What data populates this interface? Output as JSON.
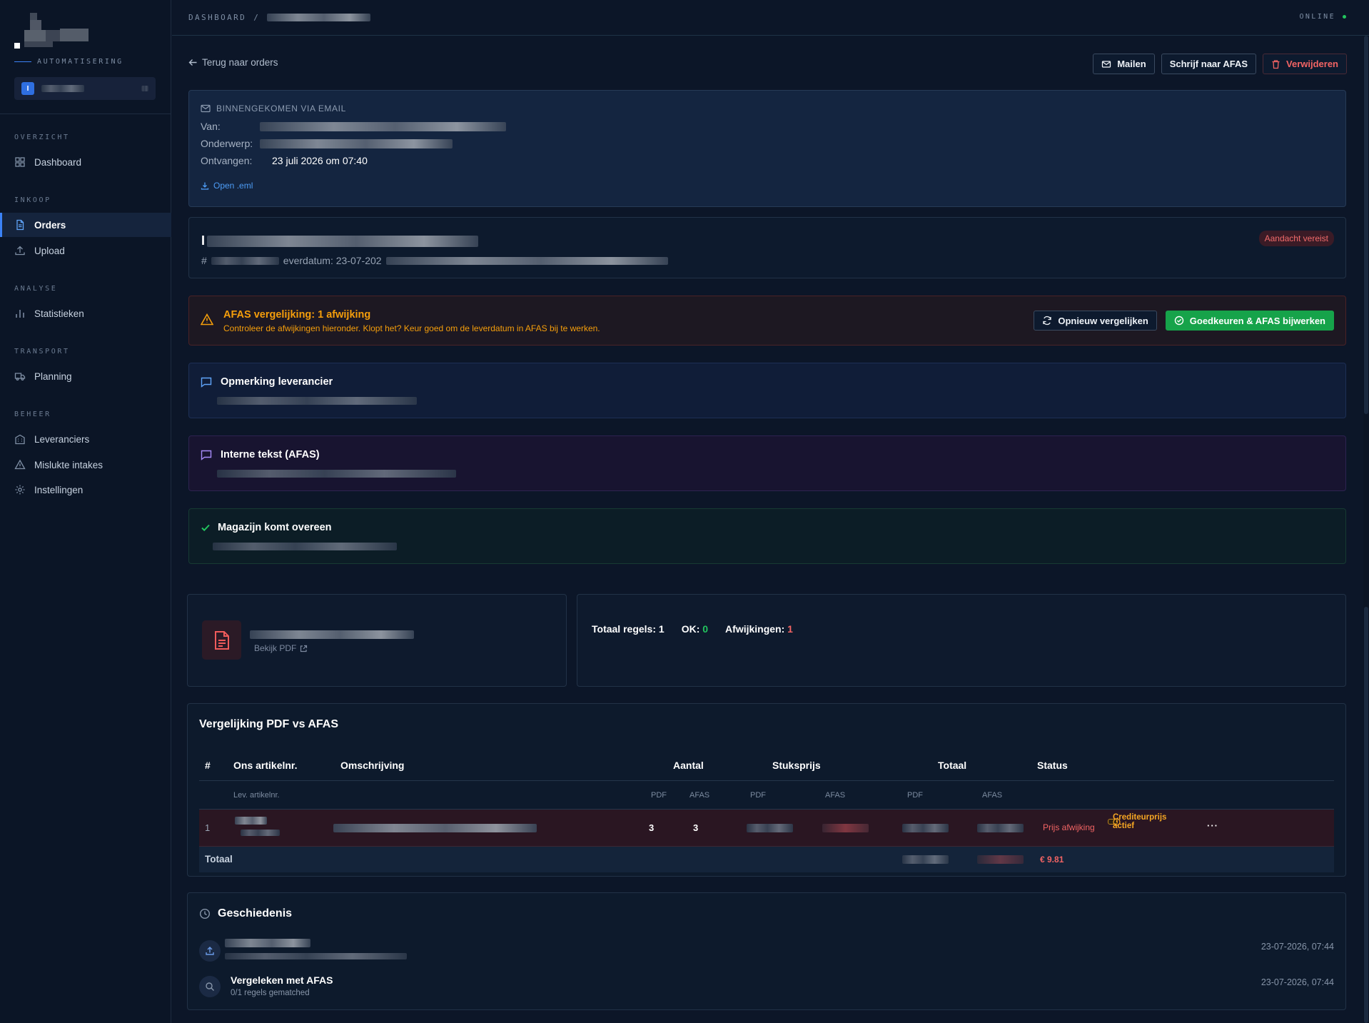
{
  "brand": {
    "subtitle": "AUTOMATISERING",
    "org_badge": "I"
  },
  "nav": {
    "sections": [
      {
        "label": "OVERZICHT",
        "items": [
          {
            "label": "Dashboard",
            "icon": "grid-icon"
          }
        ]
      },
      {
        "label": "INKOOP",
        "items": [
          {
            "label": "Orders",
            "icon": "document-icon",
            "active": true
          },
          {
            "label": "Upload",
            "icon": "upload-icon"
          }
        ]
      },
      {
        "label": "ANALYSE",
        "items": [
          {
            "label": "Statistieken",
            "icon": "bar-chart-icon"
          }
        ]
      },
      {
        "label": "TRANSPORT",
        "items": [
          {
            "label": "Planning",
            "icon": "truck-icon"
          }
        ]
      },
      {
        "label": "BEHEER",
        "items": [
          {
            "label": "Leveranciers",
            "icon": "building-icon"
          },
          {
            "label": "Mislukte intakes",
            "icon": "warning-icon"
          },
          {
            "label": "Instellingen",
            "icon": "gear-icon"
          }
        ]
      }
    ]
  },
  "topbar": {
    "breadcrumb_root": "DASHBOARD",
    "breadcrumb_sep": "/",
    "status": "ONLINE"
  },
  "toolbar": {
    "back": "Terug naar orders",
    "mail": "Mailen",
    "write_afas": "Schrijf naar AFAS",
    "delete": "Verwijderen"
  },
  "email": {
    "heading": "BINNENGEKOMEN VIA EMAIL",
    "from_label": "Van:",
    "subject_label": "Onderwerp:",
    "received_label": "Ontvangen:",
    "received_value": "23 juli 2026 om 07:40",
    "open_eml": "Open .eml"
  },
  "order": {
    "title_prefix": "I",
    "meta_hash": "#",
    "meta_delivery": "everdatum: 23-07-202",
    "badge": "Aandacht vereist"
  },
  "afas_compare": {
    "title": "AFAS vergelijking: 1 afwijking",
    "subtitle": "Controleer de afwijkingen hieronder. Klopt het? Keur goed om de leverdatum in AFAS bij te werken.",
    "recompare": "Opnieuw vergelijken",
    "approve": "Goedkeuren & AFAS bijwerken"
  },
  "notes": {
    "supplier_title": "Opmerking leverancier",
    "internal_title": "Interne tekst (AFAS)",
    "magazijn_title": "Magazijn komt overeen"
  },
  "pdf": {
    "view": "Bekijk PDF"
  },
  "stats": {
    "total_label": "Totaal regels:",
    "total": "1",
    "ok_label": "OK:",
    "ok": "0",
    "dev_label": "Afwijkingen:",
    "dev": "1"
  },
  "comparison": {
    "title": "Vergelijking PDF vs AFAS",
    "headers": {
      "num": "#",
      "our_art": "Ons artikelnr.",
      "desc": "Omschrijving",
      "qty": "Aantal",
      "unit_price": "Stuksprijs",
      "total": "Totaal",
      "status": "Status"
    },
    "subheaders": {
      "sup_art": "Lev. artikelnr.",
      "pdf": "PDF",
      "afas": "AFAS"
    },
    "row": {
      "num": "1",
      "qty_pdf": "3",
      "qty_afas": "3",
      "status": "Prijs afwijking",
      "badge": "Crediteurprijs actief",
      "more": "···"
    },
    "total_label": "Totaal",
    "total_afas": "€ 9.81"
  },
  "history": {
    "title": "Geschiedenis",
    "items": [
      {
        "main": "",
        "sub": "",
        "time": "23-07-2026, 07:44"
      },
      {
        "main": "Vergeleken met AFAS",
        "sub": "0/1 regels gematched",
        "time": "23-07-2026, 07:44"
      }
    ]
  }
}
